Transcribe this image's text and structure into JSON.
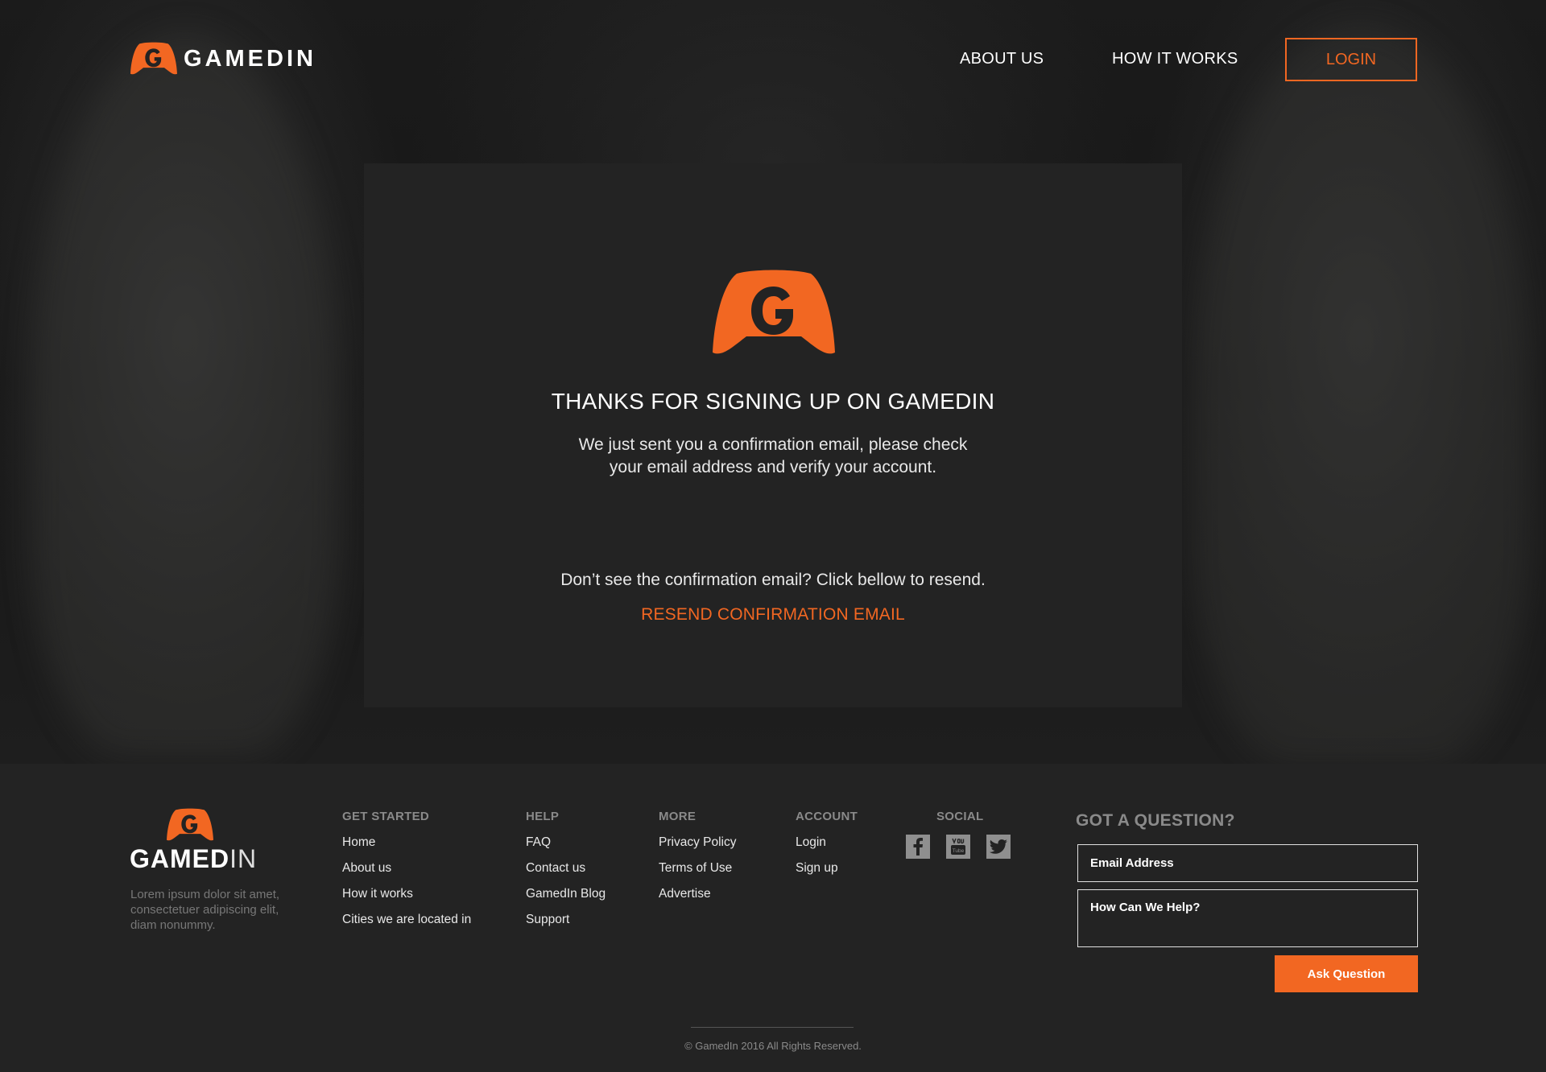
{
  "brand": {
    "name": "GAMEDIN",
    "accent_color": "#f26722",
    "logo_icon": "gamedin-g-controller-icon"
  },
  "nav": {
    "about": "ABOUT US",
    "how": "HOW IT WORKS",
    "login": "LOGIN"
  },
  "card": {
    "title": "THANKS FOR SIGNING UP ON GAMEDIN",
    "message": "We just sent you a confirmation email, please check your email address and verify your account.",
    "resend_prompt": "Don’t see the confirmation email? Click bellow to resend.",
    "resend_link": "RESEND CONFIRMATION EMAIL"
  },
  "footer": {
    "logo_bold": "GAMED",
    "logo_thin": "IN",
    "description": "Lorem ipsum dolor sit amet, consectetuer adipiscing elit, diam nonummy.",
    "columns": {
      "started": {
        "title": "GET STARTED",
        "items": [
          "Home",
          "About us",
          "How it works",
          "Cities we are located in"
        ]
      },
      "help": {
        "title": "HELP",
        "items": [
          "FAQ",
          "Contact us",
          "GamedIn Blog",
          "Support"
        ]
      },
      "more": {
        "title": "MORE",
        "items": [
          "Privacy Policy",
          "Terms of Use",
          "Advertise"
        ]
      },
      "account": {
        "title": "ACCOUNT",
        "items": [
          "Login",
          "Sign up"
        ]
      },
      "social": {
        "title": "SOCIAL",
        "icons": [
          "facebook-icon",
          "youtube-icon",
          "twitter-icon"
        ]
      }
    },
    "question": {
      "title": "GOT A QUESTION?",
      "email_placeholder": "Email Address",
      "help_placeholder": "How Can We Help?",
      "button": "Ask Question"
    },
    "copyright": "© GamedIn 2016 All Rights Reserved."
  }
}
